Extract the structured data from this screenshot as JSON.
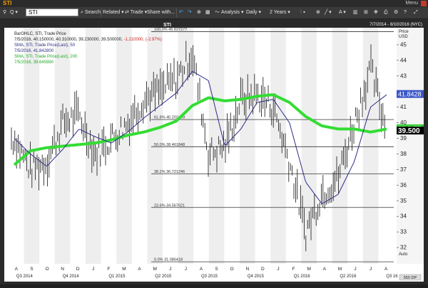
{
  "window": {
    "title": "STI",
    "menu_label": "Menu"
  },
  "toolbar": {
    "search_label": "Search",
    "related_label": "Related",
    "trade_label": "Trade",
    "share_label": "Share with...",
    "analysis_label": "Analysis",
    "display_label": "Daily",
    "period_label": "2 Years",
    "symbol": "STI"
  },
  "header": {
    "title": "STI",
    "date_range": "7/7/2014 - 8/10/2016 (NYC)",
    "info_line1": "BarOHLC, STI, Trade Price",
    "info_line2_a": "7/5/2016, 40.150000, 40.310000, 39.230000, 39.500000,",
    "info_line2_b": "-1.210000, (-2.97%)",
    "sma50_label": "SMA, STI, Trade Price(Last), 50",
    "sma50_value": "7/5/2016, 41.842800",
    "sma200_label": "SMA, STI, Trade Price(Last), 200",
    "sma200_value": "7/5/2016, 39.645980"
  },
  "axis": {
    "price_label": "Price",
    "currency_label": "USD",
    "auto_label": "Auto",
    "zoom_label": "550 DP",
    "price_ticks": [
      "45",
      "44",
      "43",
      "41",
      "40",
      "39",
      "38",
      "37",
      "36",
      "35",
      "34",
      "33",
      "32"
    ],
    "month_ticks": [
      "A",
      "S",
      "O",
      "N",
      "D",
      "J",
      "F",
      "M",
      "A",
      "M",
      "J",
      "J",
      "A",
      "S",
      "O",
      "N",
      "D",
      "J",
      "F",
      "M",
      "A",
      "M",
      "J",
      "J",
      "A"
    ],
    "quarter_labels": [
      "Q3 2014",
      "Q4 2014",
      "Q1 2015",
      "Q2 2015",
      "Q3 2015",
      "Q4 2015",
      "Q1 2016",
      "Q2 2016",
      "Q3 16"
    ]
  },
  "fib_levels": [
    {
      "pct": "100.0%",
      "value": "45.837277"
    },
    {
      "pct": "61.8%",
      "value": "40.202449"
    },
    {
      "pct": "50.0%",
      "value": "38.461848"
    },
    {
      "pct": "38.2%",
      "value": "36.721246"
    },
    {
      "pct": "23.6%",
      "value": "34.567621"
    },
    {
      "pct": "0.0%",
      "value": "31.086418"
    }
  ],
  "price_badges": {
    "sma50": "41.8428",
    "sma200": "39.6455",
    "last": "39.500"
  },
  "colors": {
    "background": "#ffffff",
    "stripe": "#eeeeee",
    "sma200": "#33dd33",
    "sma50": "#2c2c8a",
    "price_bars": "#111111",
    "fib_line": "#333333",
    "badge_green": "#33cc33",
    "badge_blue": "#3a56c8",
    "badge_last": "#000000",
    "accent": "#f0a000"
  },
  "chart_data": {
    "type": "line",
    "title": "STI",
    "x": [
      "2014-08",
      "2014-09",
      "2014-10",
      "2014-11",
      "2014-12",
      "2015-01",
      "2015-02",
      "2015-03",
      "2015-04",
      "2015-05",
      "2015-06",
      "2015-07",
      "2015-08",
      "2015-09",
      "2015-10",
      "2015-11",
      "2015-12",
      "2016-01",
      "2016-02",
      "2016-03",
      "2016-04",
      "2016-05",
      "2016-06",
      "2016-07"
    ],
    "series": [
      {
        "values": [
          39.0,
          37.0,
          37.5,
          40.0,
          40.5,
          38.0,
          39.0,
          40.0,
          41.5,
          42.0,
          42.8,
          44.5,
          38.0,
          38.5,
          41.5,
          41.8,
          41.0,
          37.5,
          33.0,
          35.5,
          36.5,
          40.0,
          43.5,
          39.5
        ]
      },
      {
        "name": "SMA, STI, Trade Price(Last), 50",
        "values": [
          39.0,
          38.0,
          37.2,
          38.3,
          39.6,
          39.1,
          38.7,
          39.4,
          40.3,
          41.1,
          41.9,
          43.3,
          42.7,
          38.5,
          39.6,
          41.3,
          41.5,
          40.0,
          36.2,
          34.8,
          35.4,
          37.5,
          41.0,
          41.8
        ]
      },
      {
        "name": "SMA, STI, Trade Price(Last), 200",
        "values": [
          37.3,
          38.2,
          38.4,
          38.5,
          38.6,
          38.7,
          38.9,
          39.2,
          39.4,
          39.7,
          40.1,
          41.1,
          41.6,
          41.4,
          41.5,
          41.7,
          41.8,
          41.3,
          40.4,
          39.8,
          39.6,
          39.6,
          39.4,
          39.6
        ]
      }
    ],
    "ylim": [
      31,
      46
    ],
    "grid": false,
    "legend": "top-left"
  }
}
